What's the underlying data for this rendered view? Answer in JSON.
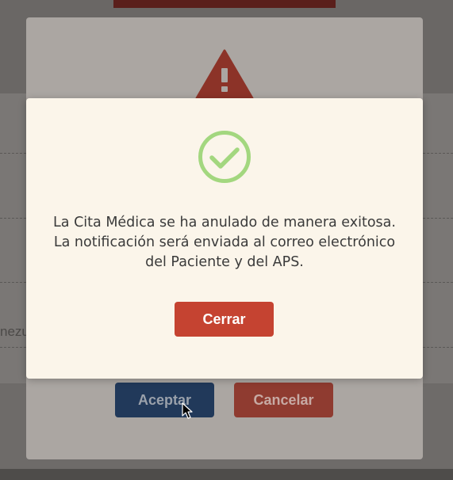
{
  "background_page": {
    "edge_text": "nezu"
  },
  "confirm_dialog": {
    "accept_label": "Aceptar",
    "cancel_label": "Cancelar",
    "icon": "warning-triangle-icon"
  },
  "success_dialog": {
    "icon": "check-circle-icon",
    "message_lines": [
      "La Cita Médica se ha anulado de manera exitosa.",
      "La notificación será enviada al correo electrónico",
      "del Paciente y del APS."
    ],
    "close_label": "Cerrar"
  },
  "colors": {
    "success_green": "#a3d77f",
    "danger_red": "#c54331",
    "primary_navy": "#21395a",
    "dialog_background": "#fbf5ea"
  }
}
